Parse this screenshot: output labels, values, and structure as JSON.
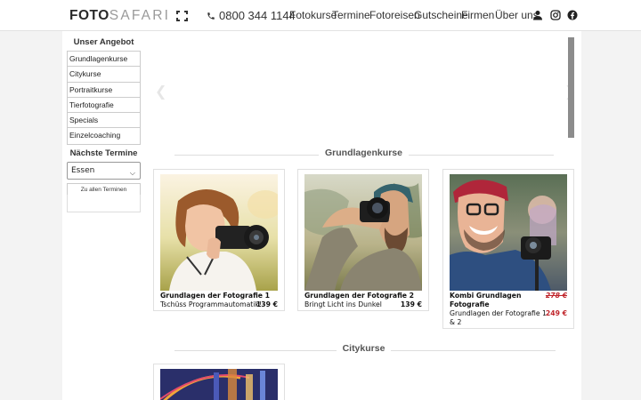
{
  "header": {
    "logo_bold": "FOTO",
    "logo_light": "SAFARI",
    "phone": "0800 344 1144",
    "nav": [
      "Fotokurse",
      "Termine",
      "Fotoreisen",
      "Gutscheine",
      "Firmen",
      "Über uns"
    ],
    "icons": [
      "user-icon",
      "instagram-icon",
      "facebook-icon"
    ]
  },
  "sidebar": {
    "offer_title": "Unser Angebot",
    "items": [
      "Grundlagenkurse",
      "Citykurse",
      "Portraitkurse",
      "Tierfotografie",
      "Specials",
      "Einzelcoaching"
    ],
    "dates_title": "Nächste Termine",
    "city_select": "Essen",
    "all_dates_button": "Zu allen Terminen"
  },
  "sections": [
    {
      "title": "Grundlagenkurse",
      "cards": [
        {
          "title": "Grundlagen der Fotografie 1",
          "subtitle": "Tschüss Programmautomatik!",
          "price": "139 €"
        },
        {
          "title": "Grundlagen der Fotografie 2",
          "subtitle": "Bringt Licht ins Dunkel",
          "price": "139 €"
        },
        {
          "title_line1": "Kombi Grundlagen",
          "title_line2": "Fotografie",
          "subtitle_line1": "Grundlagen der Fotografie 1",
          "subtitle_line2": "& 2",
          "old_price": "278 €",
          "price": "249 €"
        }
      ]
    },
    {
      "title": "Citykurse",
      "cards": []
    }
  ],
  "colors": {
    "sale": "#c0262c",
    "header_bg": "#ffffff",
    "page_bg": "#f3f3f3"
  }
}
